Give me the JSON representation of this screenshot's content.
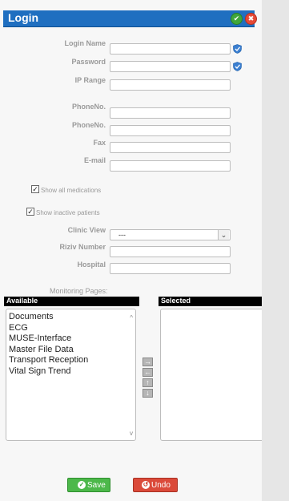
{
  "window": {
    "title": "Login",
    "ok_icon": "check-circle-icon",
    "close_icon": "close-circle-icon",
    "title_bg": "#1f6fc0"
  },
  "form": {
    "login_name": {
      "label": "Login Name",
      "value": ""
    },
    "password": {
      "label": "Password",
      "value": ""
    },
    "ip_range": {
      "label": "IP Range",
      "value": ""
    },
    "phone1": {
      "label": "PhoneNo.",
      "value": ""
    },
    "phone2": {
      "label": "PhoneNo.",
      "value": ""
    },
    "fax": {
      "label": "Fax",
      "value": ""
    },
    "email": {
      "label": "E-mail",
      "value": ""
    },
    "show_all_medications": {
      "label": "Show all medications",
      "checked": true
    },
    "show_inactive_patients": {
      "label": "Show inactive patients",
      "checked": true
    },
    "clinic_view": {
      "label": "Clinic View",
      "value": "---"
    },
    "riziv_number": {
      "label": "Riziv Number",
      "value": ""
    },
    "hospital": {
      "label": "Hospital",
      "value": ""
    }
  },
  "monitoring": {
    "label": "Monitoring Pages:",
    "available_header": "Available",
    "selected_header": "Selected",
    "available_items": [
      "Documents",
      "ECG",
      "MUSE-Interface",
      "Master File Data",
      "Transport Reception",
      "Vital Sign Trend"
    ],
    "selected_items": [],
    "move_buttons": {
      "move_right": "→",
      "move_left": "←",
      "move_up": "↑",
      "move_down": "↓"
    }
  },
  "actions": {
    "save_label": "Save",
    "undo_label": "Undo",
    "save_color": "#4cb84a",
    "undo_color": "#db4a3a"
  }
}
